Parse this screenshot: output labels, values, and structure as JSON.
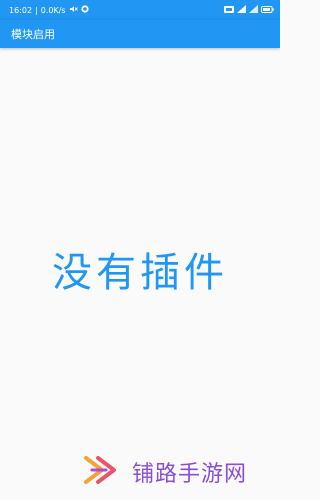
{
  "status_bar": {
    "time": "16:02",
    "speed": "0.0K/s",
    "background_color": "#2196f3"
  },
  "app_bar": {
    "title": "模块启用",
    "background_color": "#2196f3"
  },
  "main": {
    "empty_message": "没有插件",
    "text_color": "#2196f3"
  },
  "watermark": {
    "text": "铺路手游网"
  }
}
